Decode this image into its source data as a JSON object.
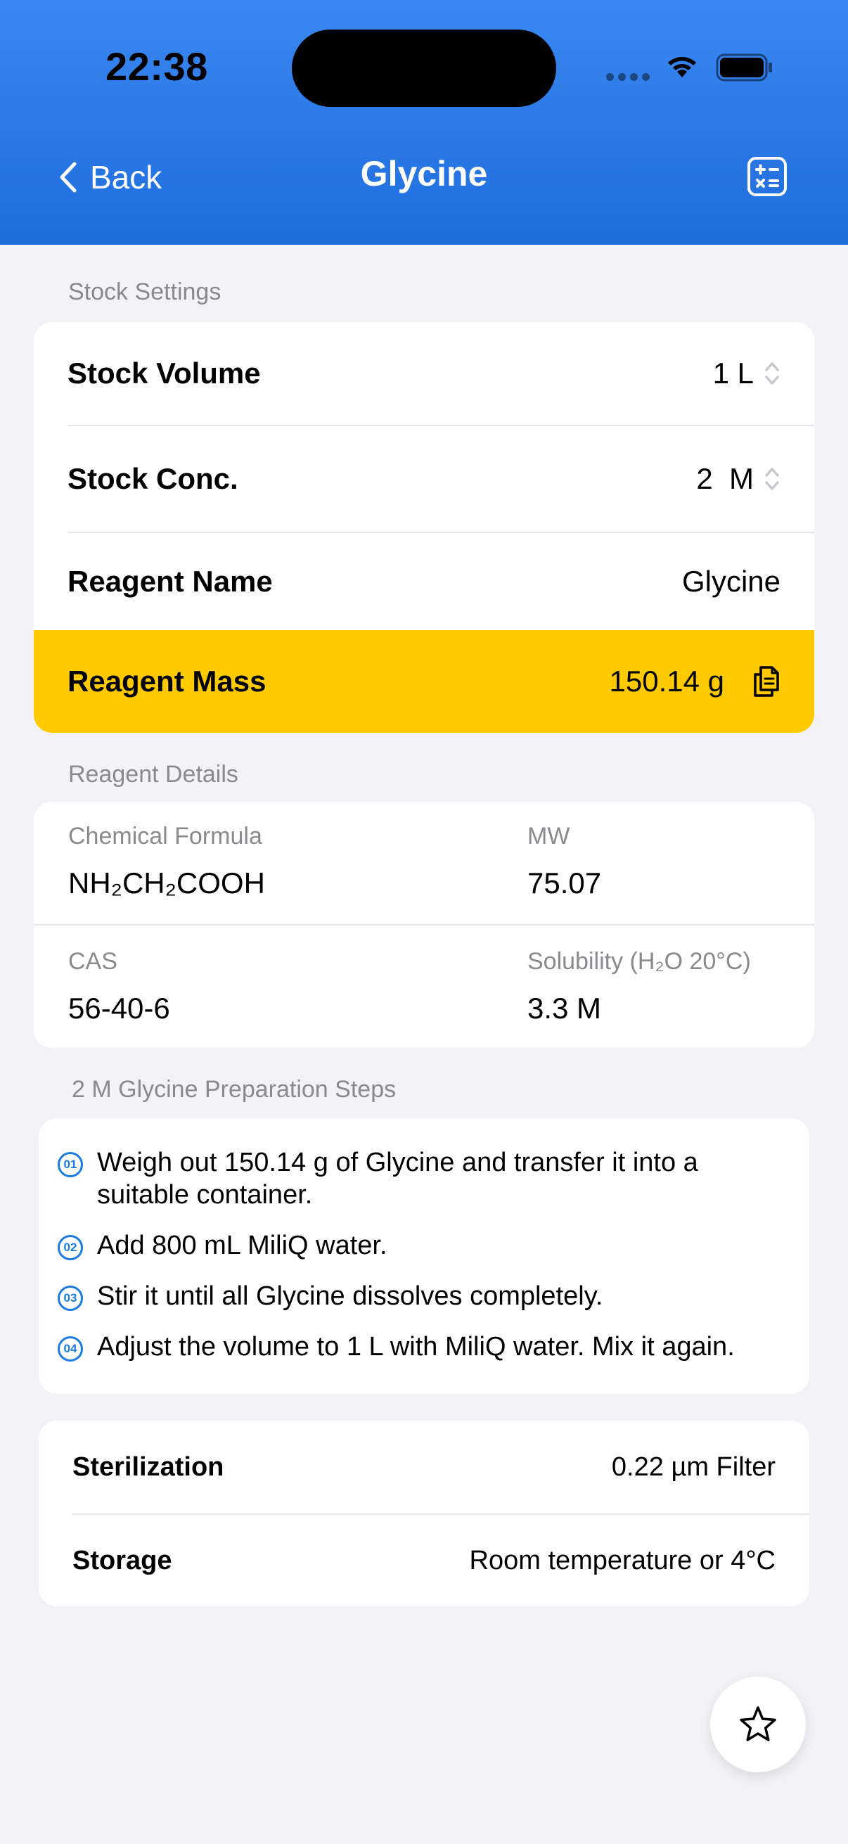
{
  "status_bar": {
    "time": "22:38"
  },
  "nav": {
    "back_label": "Back",
    "title": "Glycine",
    "calc_icon": "calculator-icon"
  },
  "stock_settings": {
    "section_label": "Stock Settings",
    "volume": {
      "label": "Stock Volume",
      "value": "1 L"
    },
    "conc": {
      "label": "Stock Conc.",
      "value": "2  M"
    },
    "reagent_name": {
      "label": "Reagent Name",
      "value": "Glycine"
    },
    "reagent_mass": {
      "label": "Reagent Mass",
      "value": "150.14 g"
    },
    "highlight_color": "#FFCB00"
  },
  "reagent_details": {
    "section_label": "Reagent Details",
    "formula": {
      "label": "Chemical Formula",
      "value": "NH₂CH₂COOH"
    },
    "mw": {
      "label": "MW",
      "value": "75.07"
    },
    "cas": {
      "label": "CAS",
      "value": "56-40-6"
    },
    "solubility": {
      "label": "Solubility (H₂O 20°C)",
      "value": "3.3 M"
    }
  },
  "preparation": {
    "section_label": "2 M Glycine Preparation Steps",
    "steps": [
      {
        "num": "01",
        "line1": "Weigh out 150.14 g of Glycine and transfer it into a",
        "line2": "suitable container."
      },
      {
        "num": "02",
        "text": "Add 800 mL MiliQ water."
      },
      {
        "num": "03",
        "text": "Stir it until all Glycine dissolves completely."
      },
      {
        "num": "04",
        "text": "Adjust the volume to 1 L with MiliQ water. Mix it again."
      }
    ]
  },
  "handling": {
    "sterilization": {
      "label": "Sterilization",
      "value": "0.22 µm Filter"
    },
    "storage": {
      "label": "Storage",
      "value": "Room temperature or 4°C"
    }
  },
  "colors": {
    "accent": "#1A7BE3",
    "header": "#2A7AEA",
    "background": "#F2F2F7"
  }
}
